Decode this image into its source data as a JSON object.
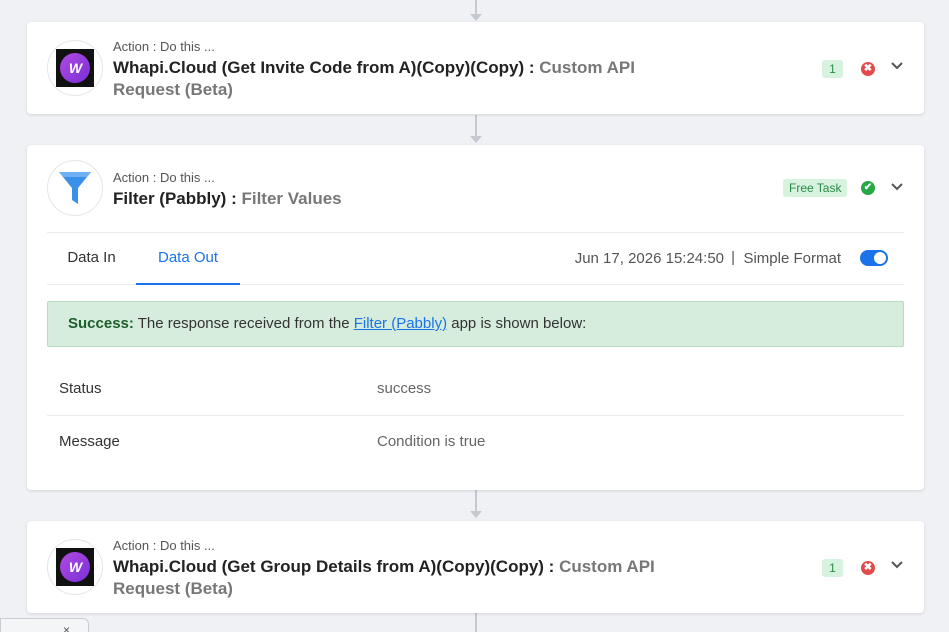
{
  "steps": [
    {
      "action_label": "Action : Do this ...",
      "title_main": "Whapi.Cloud (Get Invite Code from A)(Copy)(Copy) : ",
      "title_suffix": "Custom API Request (Beta)",
      "count_badge": "1",
      "status": "error",
      "status_icon": "✖",
      "logo_text": "W"
    },
    {
      "action_label": "Action : Do this ...",
      "title_main": "Filter (Pabbly) : ",
      "title_suffix": "Filter Values",
      "free_badge": "Free Task",
      "status": "success",
      "status_icon": "✔",
      "tabs": [
        {
          "label": "Data In",
          "active": false
        },
        {
          "label": "Data Out",
          "active": true
        }
      ],
      "timestamp": "Jun 17, 2026 15:24:50",
      "separator": "|",
      "format_label": "Simple Format",
      "format_toggle_on": true,
      "success_message": {
        "strong": "Success:",
        "before_link": " The response received from the ",
        "link": "Filter (Pabbly)",
        "after_link": " app is shown below:"
      },
      "output": [
        {
          "key": "Status",
          "value": "success"
        },
        {
          "key": "Message",
          "value": "Condition is true"
        }
      ]
    },
    {
      "action_label": "Action : Do this ...",
      "title_main": "Whapi.Cloud (Get Group Details from A)(Copy)(Copy) : ",
      "title_suffix": "Custom API Request (Beta)",
      "count_badge": "1",
      "status": "error",
      "status_icon": "✖",
      "logo_text": "W"
    }
  ],
  "bottom_tab": {
    "close_glyph": "×"
  },
  "colors": {
    "accent": "#1a73e8",
    "success_bg": "#d6ecdc",
    "error": "#e14b4b",
    "ok": "#28a745",
    "whapi_purple": "#9b3fdc"
  }
}
